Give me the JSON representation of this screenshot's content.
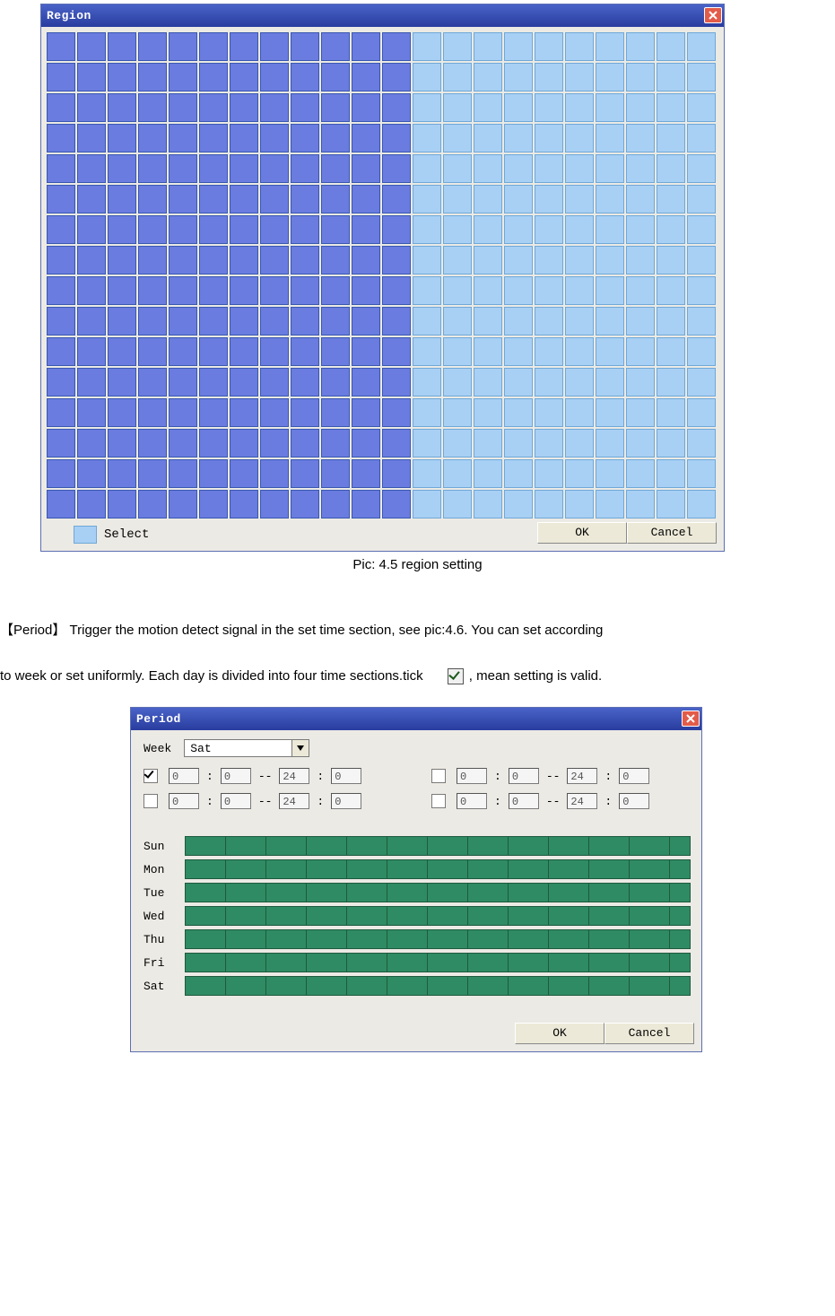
{
  "region": {
    "title": "Region",
    "legend_label": "Select",
    "ok_label": "OK",
    "cancel_label": "Cancel",
    "grid": {
      "cols": 22,
      "rows": 16,
      "selected_cols": 12
    }
  },
  "caption": "Pic: 4.5 region setting",
  "para": {
    "lead": "【Period】",
    "line1_a": "Trigger the motion detect signal in the set time section, see pic:4.6. You can set according",
    "line2_a": "to week or set uniformly. Each day is divided into four time sections.tick",
    "line2_b": ", mean setting is valid."
  },
  "period": {
    "title": "Period",
    "week_label": "Week",
    "week_value": "Sat",
    "ok_label": "OK",
    "cancel_label": "Cancel",
    "sections": [
      {
        "checked": true,
        "h1": "0",
        "m1": "0",
        "h2": "24",
        "m2": "0"
      },
      {
        "checked": false,
        "h1": "0",
        "m1": "0",
        "h2": "24",
        "m2": "0"
      },
      {
        "checked": false,
        "h1": "0",
        "m1": "0",
        "h2": "24",
        "m2": "0"
      },
      {
        "checked": false,
        "h1": "0",
        "m1": "0",
        "h2": "24",
        "m2": "0"
      }
    ],
    "days": [
      "Sun",
      "Mon",
      "Tue",
      "Wed",
      "Thu",
      "Fri",
      "Sat"
    ]
  }
}
